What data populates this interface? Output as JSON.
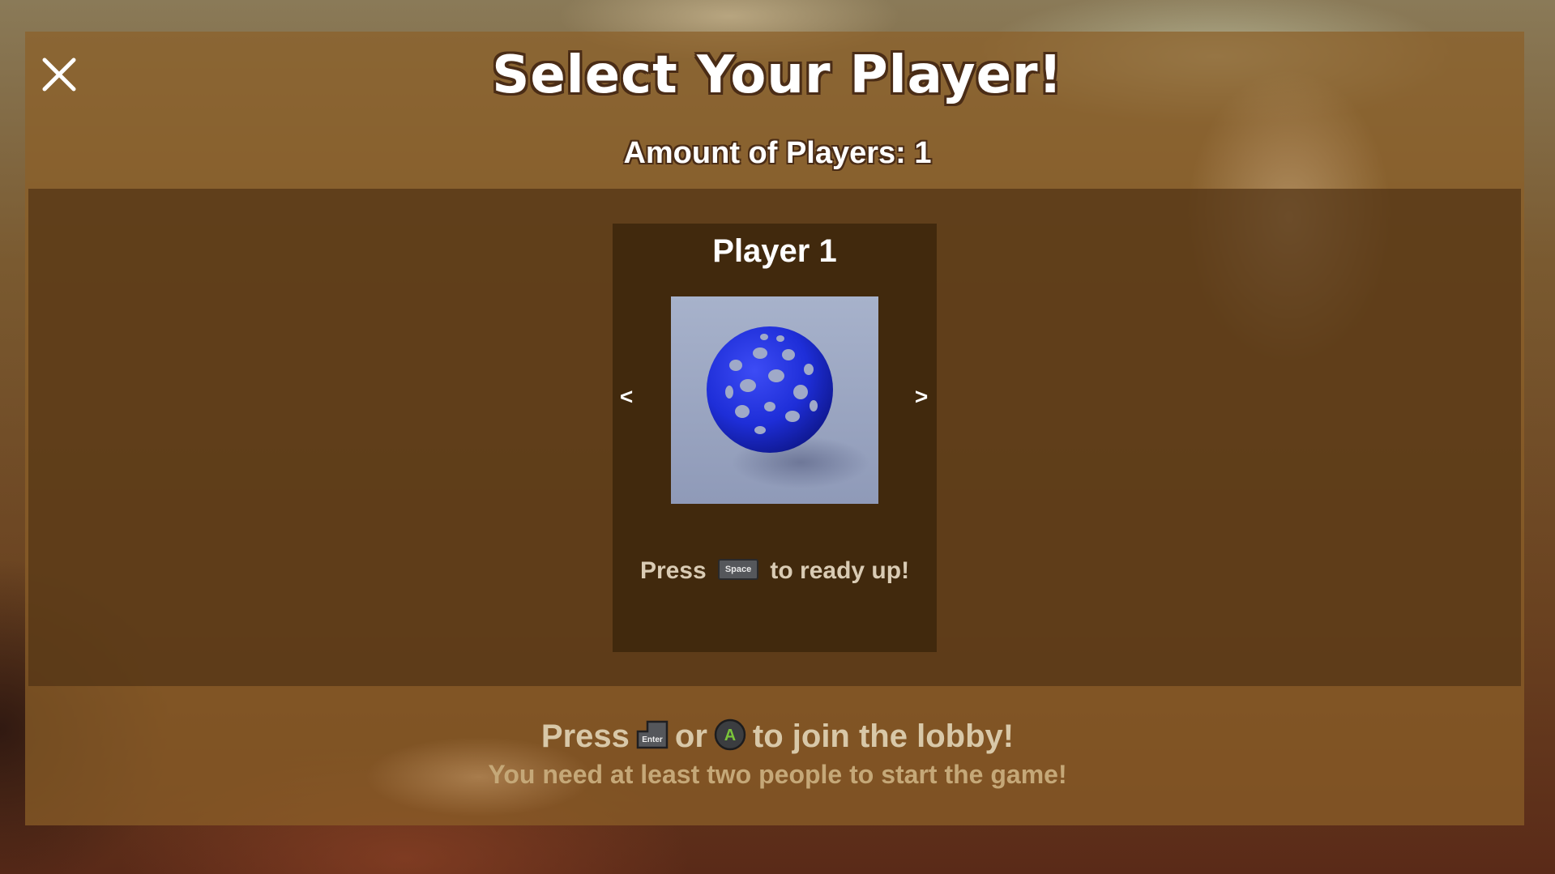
{
  "screen": {
    "title": "Select Your Player!",
    "player_count_label": "Amount of Players: 1",
    "close_icon": "close-icon"
  },
  "player_slot": {
    "name": "Player 1",
    "prev_label": "<",
    "next_label": ">",
    "ready_prefix": "Press",
    "ready_key": "Space",
    "ready_suffix": "to ready up!"
  },
  "footer": {
    "join_prefix": "Press",
    "join_key": "Enter",
    "join_or": "or",
    "join_button": "A",
    "join_suffix": "to join the lobby!",
    "hint": "You need at least two people to start the game!"
  },
  "colors": {
    "ball": "#1f2fd6",
    "preview_bg": "#9aa6c2",
    "gamepad_a": "#7ac43a"
  }
}
